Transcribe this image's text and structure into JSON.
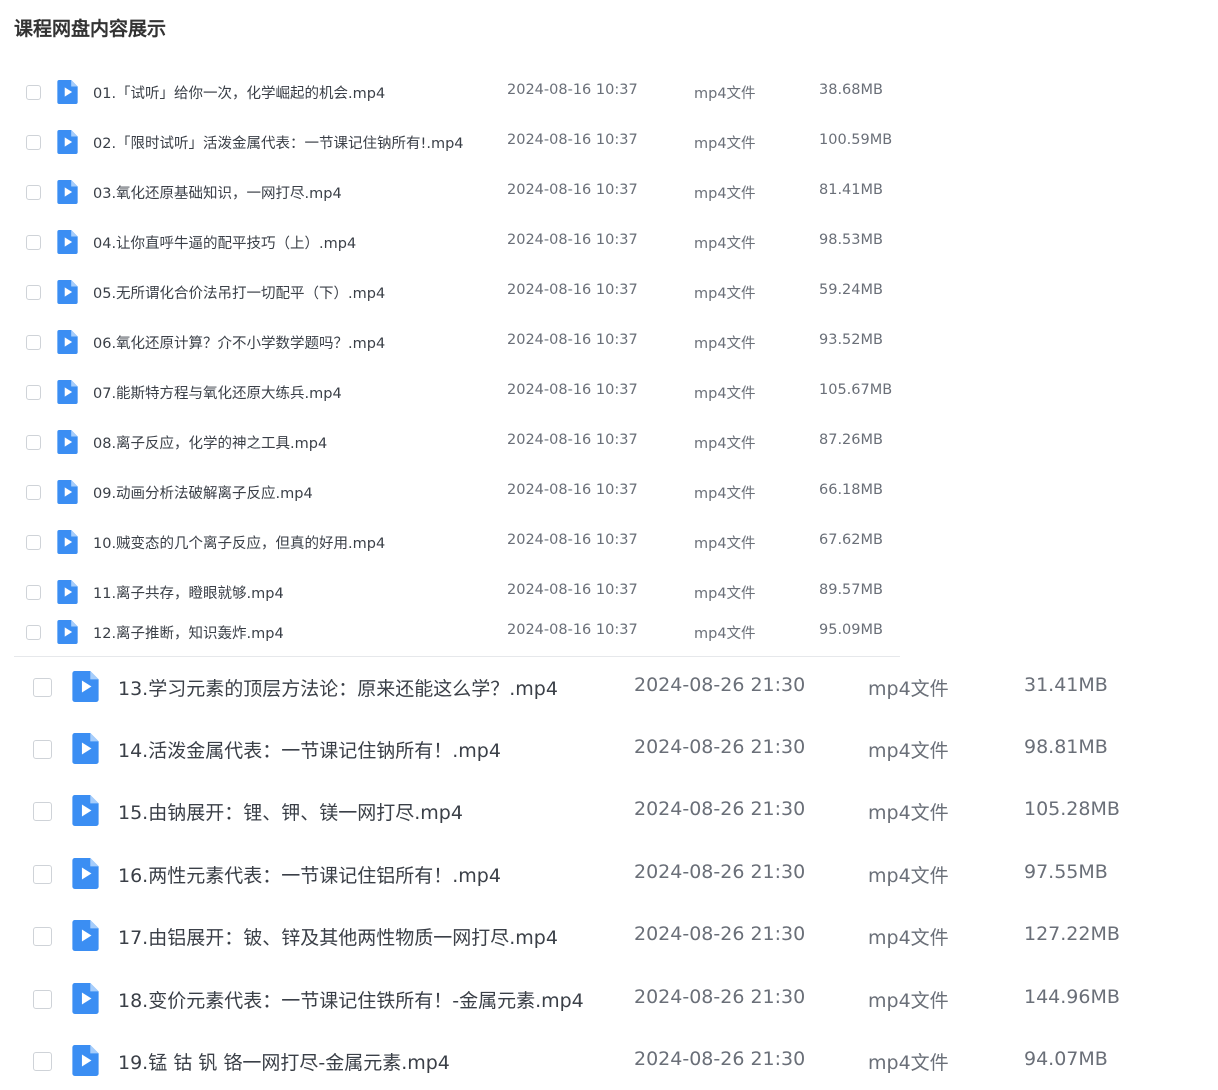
{
  "page": {
    "title": "课程网盘内容展示"
  },
  "files_group1": [
    {
      "name": "01.「试听」给你一次，化学崛起的机会.mp4",
      "date": "2024-08-16 10:37",
      "type": "mp4文件",
      "size": "38.68MB"
    },
    {
      "name": "02.「限时试听」活泼金属代表：一节课记住钠所有!.mp4",
      "date": "2024-08-16 10:37",
      "type": "mp4文件",
      "size": "100.59MB"
    },
    {
      "name": "03.氧化还原基础知识，一网打尽.mp4",
      "date": "2024-08-16 10:37",
      "type": "mp4文件",
      "size": "81.41MB"
    },
    {
      "name": "04.让你直呼牛逼的配平技巧（上）.mp4",
      "date": "2024-08-16 10:37",
      "type": "mp4文件",
      "size": "98.53MB"
    },
    {
      "name": "05.无所谓化合价法吊打一切配平（下）.mp4",
      "date": "2024-08-16 10:37",
      "type": "mp4文件",
      "size": "59.24MB"
    },
    {
      "name": "06.氧化还原计算？介不小学数学题吗？.mp4",
      "date": "2024-08-16 10:37",
      "type": "mp4文件",
      "size": "93.52MB"
    },
    {
      "name": "07.能斯特方程与氧化还原大练兵.mp4",
      "date": "2024-08-16 10:37",
      "type": "mp4文件",
      "size": "105.67MB"
    },
    {
      "name": "08.离子反应，化学的神之工具.mp4",
      "date": "2024-08-16 10:37",
      "type": "mp4文件",
      "size": "87.26MB"
    },
    {
      "name": "09.动画分析法破解离子反应.mp4",
      "date": "2024-08-16 10:37",
      "type": "mp4文件",
      "size": "66.18MB"
    },
    {
      "name": "10.贼变态的几个离子反应，但真的好用.mp4",
      "date": "2024-08-16 10:37",
      "type": "mp4文件",
      "size": "67.62MB"
    },
    {
      "name": "11.离子共存，瞪眼就够.mp4",
      "date": "2024-08-16 10:37",
      "type": "mp4文件",
      "size": "89.57MB"
    },
    {
      "name": "12.离子推断，知识轰炸.mp4",
      "date": "2024-08-16 10:37",
      "type": "mp4文件",
      "size": "95.09MB"
    }
  ],
  "files_group2": [
    {
      "name": "13.学习元素的顶层方法论：原来还能这么学？.mp4",
      "date": "2024-08-26 21:30",
      "type": "mp4文件",
      "size": "31.41MB"
    },
    {
      "name": "14.活泼金属代表：一节课记住钠所有！.mp4",
      "date": "2024-08-26 21:30",
      "type": "mp4文件",
      "size": "98.81MB"
    },
    {
      "name": "15.由钠展开：锂、钾、镁一网打尽.mp4",
      "date": "2024-08-26 21:30",
      "type": "mp4文件",
      "size": "105.28MB"
    },
    {
      "name": "16.两性元素代表：一节课记住铝所有！.mp4",
      "date": "2024-08-26 21:30",
      "type": "mp4文件",
      "size": "97.55MB"
    },
    {
      "name": "17.由铝展开：铍、锌及其他两性物质一网打尽.mp4",
      "date": "2024-08-26 21:30",
      "type": "mp4文件",
      "size": "127.22MB"
    },
    {
      "name": "18.变价元素代表：一节课记住铁所有！-金属元素.mp4",
      "date": "2024-08-26 21:30",
      "type": "mp4文件",
      "size": "144.96MB"
    },
    {
      "name": "19.锰 钴 钒 铬一网打尽-金属元素.mp4",
      "date": "2024-08-26 21:30",
      "type": "mp4文件",
      "size": "94.07MB"
    }
  ],
  "icon": {
    "file_icon": "video-file-icon",
    "color": "#3b8ef3"
  }
}
